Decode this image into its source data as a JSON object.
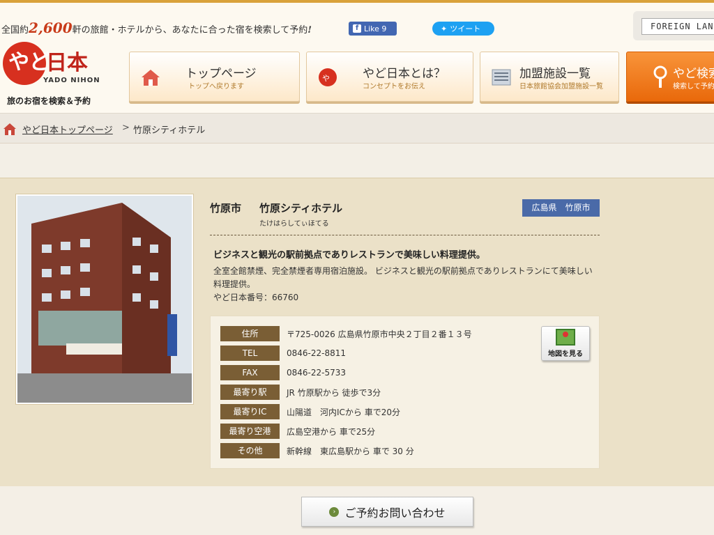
{
  "header": {
    "catch_prefix": "全国約",
    "catch_num": "2,600",
    "catch_suffix": "軒の旅館・ホテルから、あなたに合った宿を検索して予約",
    "catch_mark": "!",
    "facebook_label": "Like 9",
    "twitter_label": "ツイート",
    "language_label": "FOREIGN LANG",
    "logo_kana": "やど",
    "logo_kanji": "日本",
    "logo_romaji": "YADO NIHON",
    "logo_tagline": "旅のお宿を検索＆予約"
  },
  "nav": [
    {
      "title": "トップページ",
      "sub": "トップへ戻ります",
      "icon": "house-icon"
    },
    {
      "title": "やど日本とは？",
      "sub": "コンセプトをお伝え",
      "icon": "yado-logo-icon"
    },
    {
      "title": "加盟施設一覧",
      "sub": "日本旅館協会加盟施設一覧",
      "icon": "list-icon"
    },
    {
      "title": "やど検索",
      "sub": "検索して予約",
      "icon": "magnifier-icon"
    }
  ],
  "breadcrumb": {
    "home_label": "やど日本トップページ",
    "separator": ">",
    "current": "竹原シティホテル"
  },
  "hotel": {
    "city": "竹原市",
    "name": "竹原シティホテル",
    "kana": "たけはらしてぃほてる",
    "region_badge": "広島県　竹原市",
    "catchline": "ビジネスと観光の駅前拠点でありレストランで美味しい料理提供。",
    "description_1": "全室全館禁煙、完全禁煙者専用宿泊施設。 ビジネスと観光の駅前拠点でありレストランにて美味しい料理提供。",
    "description_2": "やど日本番号：66760"
  },
  "info": [
    {
      "label": "住所",
      "value": "〒725-0026 広島県竹原市中央２丁目２番１３号"
    },
    {
      "label": "TEL",
      "value": "0846-22-8811"
    },
    {
      "label": "FAX",
      "value": "0846-22-5733"
    },
    {
      "label": "最寄り駅",
      "value": "JR 竹原駅から 徒歩で3分"
    },
    {
      "label": "最寄りIC",
      "value": "山陽道　河内ICから 車で20分"
    },
    {
      "label": "最寄り空港",
      "value": "広島空港から 車で25分"
    },
    {
      "label": "その他",
      "value": "新幹線　東広島駅から 車で 30 分"
    }
  ],
  "map_button_label": "地図を見る",
  "reserve_button_label": "ご予約お問い合わせ",
  "colors": {
    "accent_orange": "#e9690b",
    "badge_blue": "#4a6aa8",
    "label_brown": "#7a5e35"
  }
}
